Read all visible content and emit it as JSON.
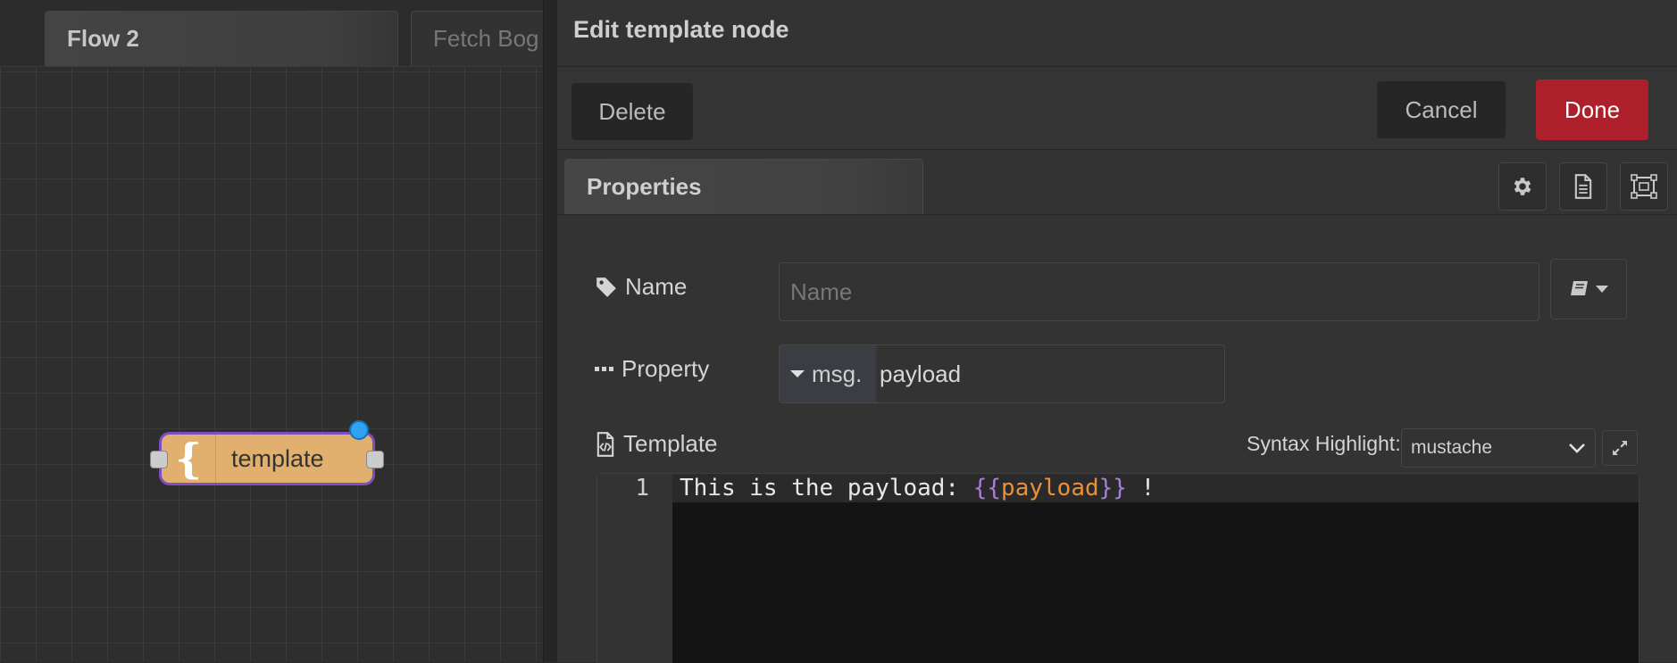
{
  "workspace": {
    "tabs": [
      {
        "label": "Flow 2",
        "active": true
      },
      {
        "label": "Fetch Bog",
        "active": false
      }
    ],
    "node": {
      "label": "template",
      "icon": "{",
      "color": "#e1b06f",
      "selected_border": "#7b4fc2",
      "changed_indicator_color": "#2ea3f2"
    }
  },
  "editor": {
    "title": "Edit template node",
    "toolbar": {
      "delete_label": "Delete",
      "cancel_label": "Cancel",
      "done_label": "Done",
      "done_color": "#ad1f2b"
    },
    "tabs": {
      "properties_label": "Properties",
      "icon_tabs": [
        "gear-icon",
        "document-icon",
        "frame-icon"
      ]
    },
    "name": {
      "label": "Name",
      "placeholder": "Name",
      "value": ""
    },
    "property": {
      "label": "Property",
      "type": "msg.",
      "value": "payload"
    },
    "template": {
      "label": "Template",
      "syntax_label": "Syntax Highlight:",
      "syntax_value": "mustache",
      "code_lines": [
        {
          "number": "1",
          "before": "This is the payload: ",
          "brace_open": "{{",
          "var": "payload",
          "brace_close": "}}",
          "after": " !"
        }
      ]
    }
  }
}
